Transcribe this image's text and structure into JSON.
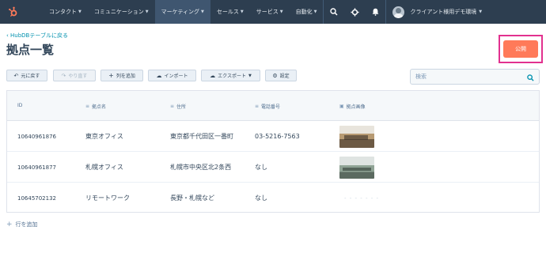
{
  "colors": {
    "nav_bg": "#2d3e50",
    "accent": "#ff7a59",
    "highlight": "#e2318f",
    "link": "#0091ae"
  },
  "topnav": {
    "logo_icon": "hubspot-sprocket-icon",
    "items": [
      {
        "label": "コンタクト"
      },
      {
        "label": "コミュニケーション"
      },
      {
        "label": "マーケティング",
        "active": true
      },
      {
        "label": "セールス"
      },
      {
        "label": "サービス"
      },
      {
        "label": "自動化"
      }
    ],
    "icons": [
      "search-icon",
      "settings-icon",
      "notifications-icon"
    ],
    "account_label": "クライアント様用デモ環境"
  },
  "header": {
    "back_link": "‹ HubDBテーブルに戻る",
    "title": "拠点一覧",
    "publish_label": "公開"
  },
  "toolbar": {
    "undo": "元に戻す",
    "redo": "やり直す",
    "add_column": "列を追加",
    "import": "インポート",
    "export": "エクスポート",
    "settings": "設定",
    "search_placeholder": "検索"
  },
  "table": {
    "columns": [
      {
        "label": "ID",
        "icon": ""
      },
      {
        "label": "拠点名",
        "icon": "text-column-icon"
      },
      {
        "label": "住所",
        "icon": "text-column-icon"
      },
      {
        "label": "電話番号",
        "icon": "text-column-icon"
      },
      {
        "label": "拠点画像",
        "icon": "image-column-icon"
      }
    ],
    "rows": [
      {
        "id": "10640961876",
        "name": "東京オフィス",
        "address": "東京都千代田区一番町",
        "phone": "03-5216-7563",
        "image": "office-photo-1"
      },
      {
        "id": "10640961877",
        "name": "札幌オフィス",
        "address": "札幌市中央区北2条西",
        "phone": "なし",
        "image": "office-photo-2"
      },
      {
        "id": "10645702132",
        "name": "リモートワーク",
        "address": "長野・札幌など",
        "phone": "なし",
        "image": "",
        "image_placeholder": "- - - - - - -"
      }
    ]
  },
  "add_row_label": "行を追加"
}
